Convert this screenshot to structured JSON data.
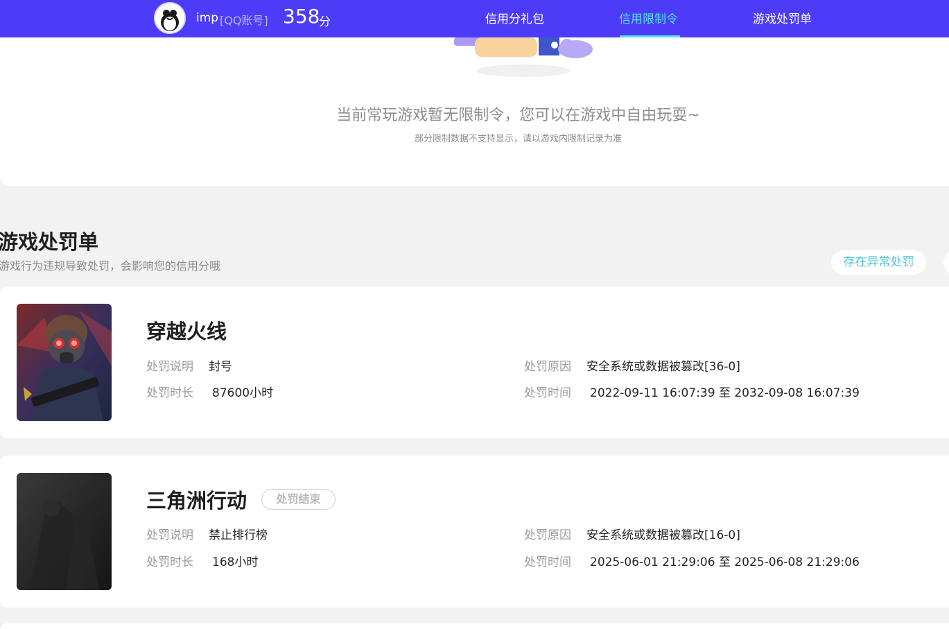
{
  "header": {
    "user_name": "imp",
    "account_type": "[QQ账号]",
    "score_value": "358",
    "score_unit": "分",
    "tabs": [
      {
        "label": "信用分礼包",
        "active": false
      },
      {
        "label": "信用限制令",
        "active": true
      },
      {
        "label": "游戏处罚单",
        "active": false
      }
    ]
  },
  "restriction": {
    "empty_title": "当前常玩游戏暂无限制令，您可以在游戏中自由玩耍~",
    "empty_note": "部分限制数据不支持显示，请以游戏内限制记录为准"
  },
  "penalty_section": {
    "title": "游戏处罚单",
    "subtitle": "游戏行为违规导致处罚，会影响您的信用分哦",
    "abnormal_button": "存在异常处罚"
  },
  "penalties": [
    {
      "game": "穿越火线",
      "status": "",
      "desc_label": "处罚说明",
      "desc_value": "封号",
      "duration_label": "处罚时长",
      "duration_value": "87600小时",
      "reason_label": "处罚原因",
      "reason_value": "安全系统或数据被篡改[36-0]",
      "time_label": "处罚时间",
      "time_value": "2022-09-11 16:07:39 至 2032-09-08 16:07:39"
    },
    {
      "game": "三角洲行动",
      "status": "处罚结束",
      "desc_label": "处罚说明",
      "desc_value": "禁止排行榜",
      "duration_label": "处罚时长",
      "duration_value": "168小时",
      "reason_label": "处罚原因",
      "reason_value": "安全系统或数据被篡改[16-0]",
      "time_label": "处罚时间",
      "time_value": "2025-06-01 21:29:06 至 2025-06-08 21:29:06"
    }
  ],
  "colors": {
    "nav_bg": "#4d3cf7",
    "nav_active": "#55e0f5",
    "accent_teal": "#4fc3d9",
    "page_bg": "#f2f2f2"
  }
}
